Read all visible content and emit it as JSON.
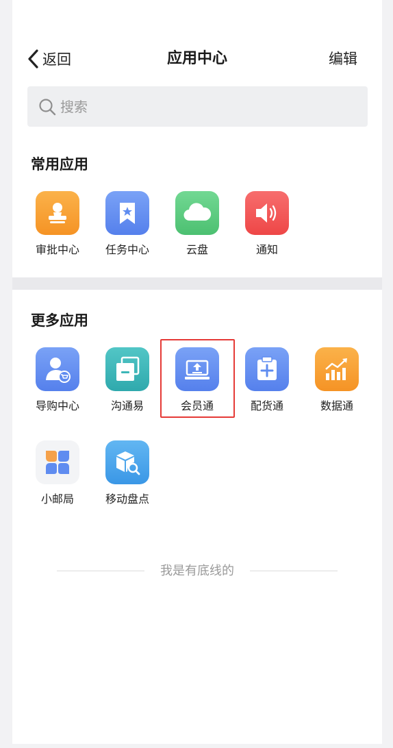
{
  "header": {
    "back_label": "返回",
    "title": "应用中心",
    "edit_label": "编辑"
  },
  "search": {
    "placeholder": "搜索"
  },
  "common_apps": {
    "title": "常用应用",
    "items": [
      {
        "label": "审批中心",
        "icon": "stamp-icon",
        "color": "#f7a337"
      },
      {
        "label": "任务中心",
        "icon": "bookmark-star-icon",
        "color": "#5f8cf0"
      },
      {
        "label": "云盘",
        "icon": "cloud-icon",
        "color": "#5ccd80"
      },
      {
        "label": "通知",
        "icon": "speaker-icon",
        "color": "#f25a5a"
      }
    ]
  },
  "more_apps": {
    "title": "更多应用",
    "items": [
      {
        "label": "导购中心",
        "icon": "user-cart-icon",
        "color": "#5f8cf0"
      },
      {
        "label": "沟通易",
        "icon": "stacked-windows-icon",
        "color": "#3cb6b8"
      },
      {
        "label": "会员通",
        "icon": "upload-tray-icon",
        "color": "#5f8cf0"
      },
      {
        "label": "配货通",
        "icon": "clipboard-plus-icon",
        "color": "#5f8cf0"
      },
      {
        "label": "数据通",
        "icon": "bar-chart-trend-icon",
        "color": "#f7a337"
      },
      {
        "label": "小邮局",
        "icon": "four-petals-icon",
        "color": "#f3f4f6"
      },
      {
        "label": "移动盘点",
        "icon": "box-search-icon",
        "color": "#4aa6ec"
      }
    ]
  },
  "footer": {
    "text": "我是有底线的"
  }
}
